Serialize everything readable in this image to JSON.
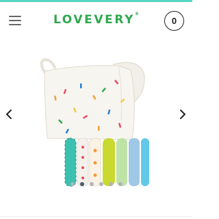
{
  "header": {
    "brand": "LOVEVERY",
    "brand_mark": "®",
    "cart_count": "0",
    "menu_icon": "hamburger-menu-icon"
  },
  "carousel": {
    "slide_count": 6,
    "active_index": 1,
    "prev_icon": "chevron-left-icon",
    "next_icon": "chevron-right-icon",
    "image": "taggie-blanket-with-ribbon-loops"
  },
  "colors": {
    "brand_green": "#2fa84f",
    "accent_teal": "#56d6c3",
    "dot_active": "#4e5a68",
    "dot_inactive": "#b0b5bd"
  }
}
